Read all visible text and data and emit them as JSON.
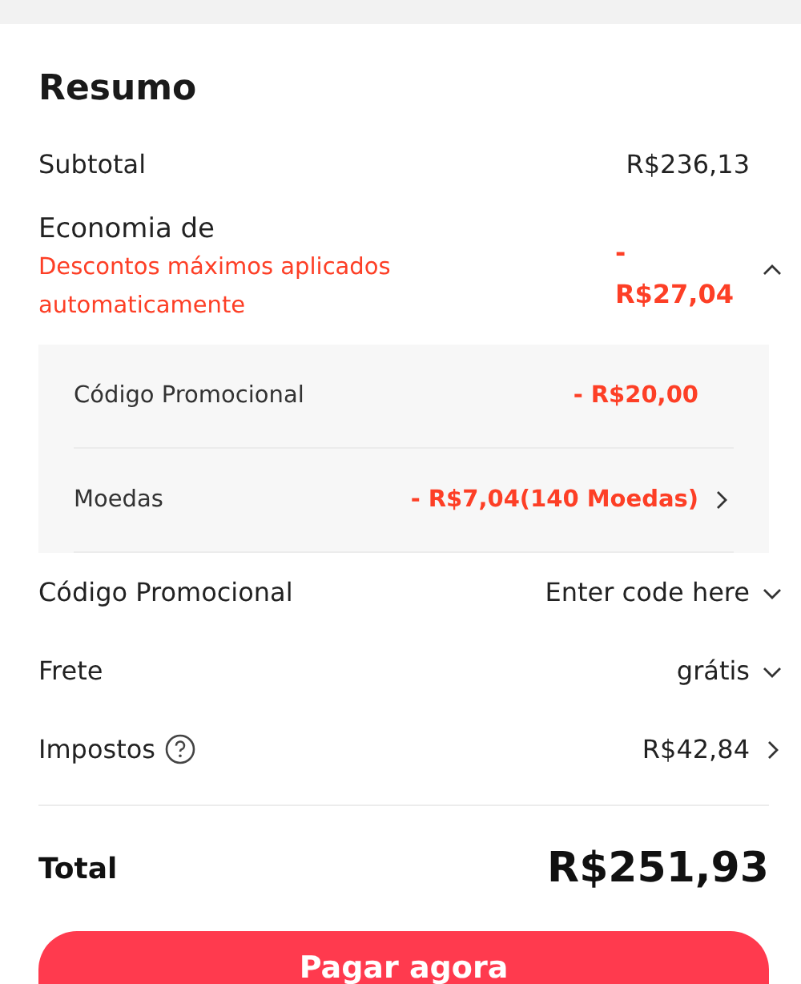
{
  "summary": {
    "title": "Resumo",
    "subtotal": {
      "label": "Subtotal",
      "value": "R$236,13"
    },
    "savings": {
      "label": "Economia de",
      "note": "Descontos máximos aplicados automaticamente",
      "sign": "-",
      "value": "R$27,04",
      "expanded": true,
      "items": [
        {
          "label": "Código Promocional",
          "value": "- R$20,00",
          "kind": "plain"
        },
        {
          "label": "Moedas",
          "value": "- R$7,04(140 Moedas)",
          "kind": "link"
        }
      ]
    },
    "rows": [
      {
        "label": "Código Promocional",
        "value": "Enter code here",
        "kind": "dropdown",
        "help": false
      },
      {
        "label": "Frete",
        "value": "grátis",
        "kind": "dropdown",
        "help": false
      },
      {
        "label": "Impostos",
        "value": "R$42,84",
        "kind": "link",
        "help": true
      }
    ],
    "total": {
      "label": "Total",
      "value": "R$251,93"
    },
    "pay_button": "Pagar agora"
  }
}
